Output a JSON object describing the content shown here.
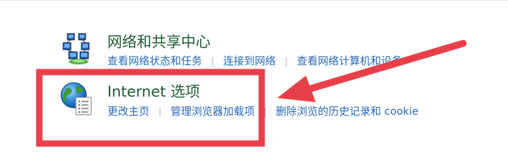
{
  "network": {
    "title": "网络和共享中心",
    "links": [
      "查看网络状态和任务",
      "连接到网络",
      "查看网络计算机和设备"
    ]
  },
  "internet": {
    "title": "Internet 选项",
    "links": [
      "更改主页",
      "管理浏览器加载项",
      "删除浏览的历史记录和 cookie"
    ]
  },
  "icons": {
    "network": "network-computers-icon",
    "internet": "globe-document-icon"
  },
  "colors": {
    "title": "#1e5b32",
    "link": "#2a6ab7",
    "separator": "#b9b9b9",
    "annotation": "#e8404a"
  }
}
